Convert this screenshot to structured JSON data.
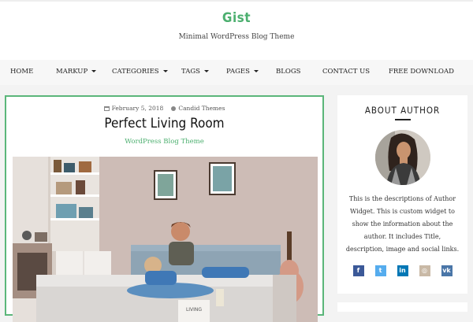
{
  "site": {
    "title": "Gist",
    "tagline": "Minimal WordPress Blog Theme"
  },
  "nav": {
    "items": [
      {
        "label": "HOME",
        "dropdown": false
      },
      {
        "label": "MARKUP",
        "dropdown": true
      },
      {
        "label": "CATEGORIES",
        "dropdown": true
      },
      {
        "label": "TAGS",
        "dropdown": true
      },
      {
        "label": "PAGES",
        "dropdown": true
      },
      {
        "label": "BLOGS",
        "dropdown": false
      },
      {
        "label": "CONTACT US",
        "dropdown": false
      },
      {
        "label": "FREE DOWNLOAD",
        "dropdown": false
      }
    ]
  },
  "post": {
    "date": "February 5, 2018",
    "author": "Candid Themes",
    "title": "Perfect Living Room",
    "subtitle": "WordPress Blog Theme",
    "image_text": "LIVING"
  },
  "sidebar": {
    "widget_title": "ABOUT AUTHOR",
    "description": "This is the descriptions of Author Widget. This is custom widget to show the information about the author. It includes Title, description, image and social links.",
    "social": [
      {
        "icon": "facebook-icon",
        "glyph": "f",
        "color": "#3b5998"
      },
      {
        "icon": "twitter-icon",
        "glyph": "t",
        "color": "#55acee"
      },
      {
        "icon": "linkedin-icon",
        "glyph": "in",
        "color": "#0077b5"
      },
      {
        "icon": "instagram-icon",
        "glyph": "◎",
        "color": "#c9b9a6"
      },
      {
        "icon": "vk-icon",
        "glyph": "vk",
        "color": "#4a76a8"
      }
    ]
  },
  "colors": {
    "accent": "#4caf6f"
  }
}
